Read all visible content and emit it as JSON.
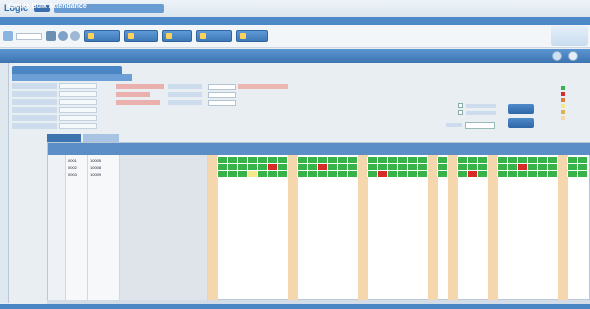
{
  "app": {
    "logo_text": "Logic"
  },
  "nav": {
    "items": [
      "",
      "",
      "",
      "",
      "",
      "",
      "",
      "",
      "",
      "",
      "",
      "",
      ""
    ]
  },
  "toolbar": {
    "buttons": [
      "",
      "",
      "",
      "",
      ""
    ]
  },
  "title": "Create Bulk Attendance",
  "colors": {
    "present": "#37b34a",
    "absent": "#d62b2b",
    "holiday": "#f4d7ad",
    "leave": "#f3e98a",
    "header": "#5b8ec7"
  },
  "grid": {
    "rows": [
      {
        "level": "0001",
        "emp": "10005",
        "name": "",
        "cells": [
          "h",
          "p",
          "p",
          "p",
          "p",
          "p",
          "p",
          "p",
          "h",
          "p",
          "p",
          "p",
          "p",
          "p",
          "p",
          "h",
          "p",
          "p",
          "p",
          "p",
          "p",
          "p",
          "h",
          "p",
          "h",
          "p",
          "p",
          "p",
          "h",
          "p",
          "p",
          "p",
          "p",
          "p",
          "p",
          "h",
          "p",
          "p"
        ]
      },
      {
        "level": "0002",
        "emp": "10008",
        "name": "",
        "cells": [
          "h",
          "p",
          "p",
          "p",
          "p",
          "p",
          "a",
          "p",
          "h",
          "p",
          "p",
          "a",
          "p",
          "p",
          "p",
          "h",
          "p",
          "p",
          "p",
          "p",
          "p",
          "p",
          "h",
          "p",
          "h",
          "p",
          "p",
          "p",
          "h",
          "p",
          "p",
          "a",
          "p",
          "p",
          "p",
          "h",
          "p",
          "p"
        ]
      },
      {
        "level": "0003",
        "emp": "10009",
        "name": "",
        "cells": [
          "h",
          "p",
          "p",
          "p",
          "l",
          "p",
          "p",
          "p",
          "h",
          "p",
          "p",
          "p",
          "p",
          "p",
          "p",
          "h",
          "p",
          "a",
          "p",
          "p",
          "p",
          "p",
          "h",
          "p",
          "h",
          "p",
          "a",
          "p",
          "h",
          "p",
          "p",
          "p",
          "p",
          "p",
          "p",
          "h",
          "p",
          "p"
        ]
      }
    ]
  }
}
